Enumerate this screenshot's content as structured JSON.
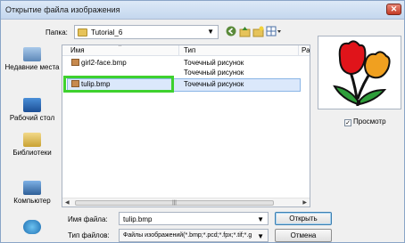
{
  "window": {
    "title": "Открытие файла изображения",
    "close": "✕"
  },
  "toolbar": {
    "lookin_label": "Папка:",
    "lookin_value": "Tutorial_6",
    "icons": [
      "back-icon",
      "up-folder-icon",
      "new-folder-icon",
      "view-menu-icon"
    ]
  },
  "places": [
    {
      "label": "Недавние места",
      "icon": "recent-places-icon"
    },
    {
      "label": "Рабочий стол",
      "icon": "desktop-icon"
    },
    {
      "label": "Библиотеки",
      "icon": "libraries-icon"
    },
    {
      "label": "Компьютер",
      "icon": "computer-icon"
    },
    {
      "label": "",
      "icon": "network-icon"
    }
  ],
  "filelist": {
    "headers": [
      "Имя",
      "Тип",
      "Раз"
    ],
    "rows": [
      {
        "name": "girl2-face.bmp",
        "type": "Точечный рисунок"
      },
      {
        "name": "",
        "type": "Точечный рисунок"
      },
      {
        "name": "tulip.bmp",
        "type": "Точечный рисунок"
      }
    ],
    "scroll_thumb": "|||"
  },
  "preview": {
    "checkbox_label": "Просмотр",
    "checked": true
  },
  "bottom": {
    "filename_label": "Имя файла:",
    "filename_value": "tulip.bmp",
    "filetype_label": "Тип файлов:",
    "filetype_value": "Файлы изображений(*.bmp;*.pcd;*.fpx;*.tif;*.g",
    "open_button": "Открыть",
    "cancel_button": "Отмена"
  },
  "colors": {
    "highlight": "#3ed12e",
    "selection": "#dbe8fb"
  }
}
